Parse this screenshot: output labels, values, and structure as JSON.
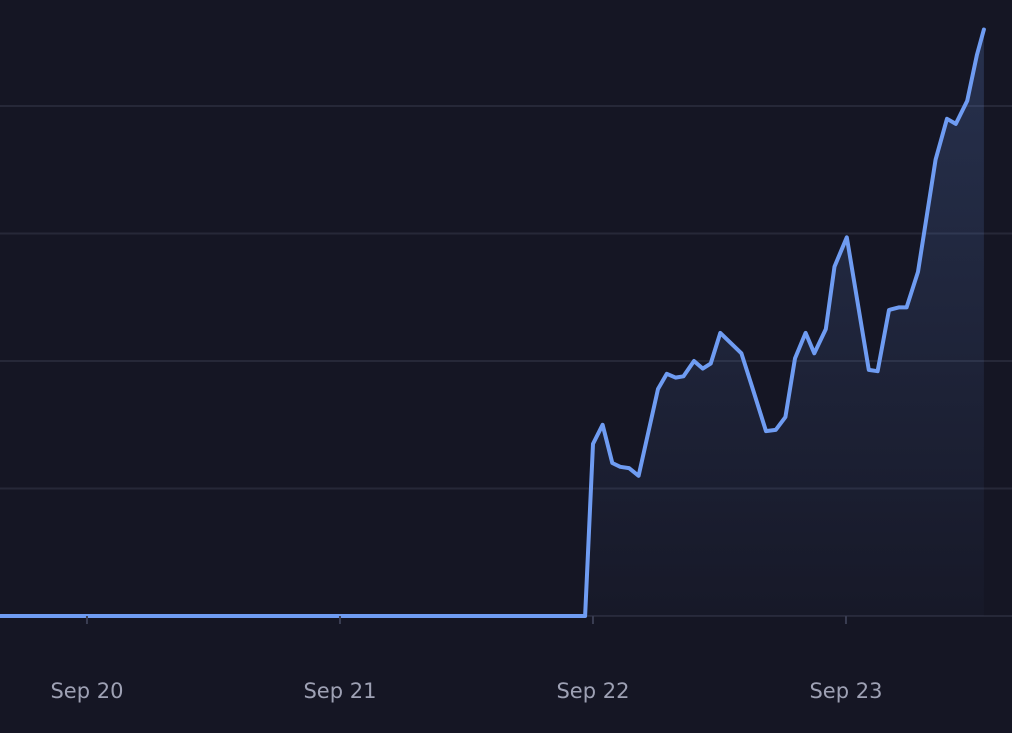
{
  "colors": {
    "background": "#151624",
    "line": "#6f9cf2",
    "grid": "#262838",
    "axis_tick": "#3a3d52",
    "tick_label": "#9ea1b4"
  },
  "chart_data": {
    "type": "area",
    "title": "",
    "xlabel": "",
    "ylabel": "",
    "grid": true,
    "legend": "none",
    "x_ticks": [
      "Sep 20",
      "Sep 21",
      "Sep 22",
      "Sep 23"
    ],
    "xlim": [
      "Sep 19 15:45",
      "Sep 23 15:45"
    ],
    "ylim": [
      0,
      4.5
    ],
    "y_gridlines": [
      0,
      1,
      2,
      3,
      4
    ],
    "series": [
      {
        "values": [
          {
            "x": "Sep 19 15:45",
            "y": 0
          },
          {
            "x": "Sep 21 23:15",
            "y": 0
          },
          {
            "x": "Sep 22 00:00",
            "y": 1.35
          },
          {
            "x": "Sep 22 00:55",
            "y": 1.5
          },
          {
            "x": "Sep 22 01:50",
            "y": 1.2
          },
          {
            "x": "Sep 22 02:35",
            "y": 1.17
          },
          {
            "x": "Sep 22 03:25",
            "y": 1.16
          },
          {
            "x": "Sep 22 04:20",
            "y": 1.1
          },
          {
            "x": "Sep 22 06:10",
            "y": 1.78
          },
          {
            "x": "Sep 22 07:00",
            "y": 1.9
          },
          {
            "x": "Sep 22 07:50",
            "y": 1.87
          },
          {
            "x": "Sep 22 08:35",
            "y": 1.88
          },
          {
            "x": "Sep 22 09:35",
            "y": 2.0
          },
          {
            "x": "Sep 22 10:25",
            "y": 1.94
          },
          {
            "x": "Sep 22 11:10",
            "y": 1.98
          },
          {
            "x": "Sep 22 12:05",
            "y": 2.22
          },
          {
            "x": "Sep 22 14:05",
            "y": 2.06
          },
          {
            "x": "Sep 22 15:05",
            "y": 1.8
          },
          {
            "x": "Sep 22 16:25",
            "y": 1.45
          },
          {
            "x": "Sep 22 17:20",
            "y": 1.46
          },
          {
            "x": "Sep 22 18:15",
            "y": 1.56
          },
          {
            "x": "Sep 22 19:10",
            "y": 2.02
          },
          {
            "x": "Sep 22 20:10",
            "y": 2.22
          },
          {
            "x": "Sep 22 21:00",
            "y": 2.06
          },
          {
            "x": "Sep 22 22:05",
            "y": 2.25
          },
          {
            "x": "Sep 22 22:55",
            "y": 2.74
          },
          {
            "x": "Sep 23 00:05",
            "y": 2.97
          },
          {
            "x": "Sep 23 02:10",
            "y": 1.93
          },
          {
            "x": "Sep 23 03:00",
            "y": 1.92
          },
          {
            "x": "Sep 23 04:05",
            "y": 2.4
          },
          {
            "x": "Sep 23 05:00",
            "y": 2.42
          },
          {
            "x": "Sep 23 05:45",
            "y": 2.42
          },
          {
            "x": "Sep 23 06:50",
            "y": 2.7
          },
          {
            "x": "Sep 23 08:30",
            "y": 3.58
          },
          {
            "x": "Sep 23 09:35",
            "y": 3.9
          },
          {
            "x": "Sep 23 10:25",
            "y": 3.86
          },
          {
            "x": "Sep 23 11:30",
            "y": 4.04
          },
          {
            "x": "Sep 23 12:25",
            "y": 4.4
          },
          {
            "x": "Sep 23 13:05",
            "y": 4.6
          }
        ]
      }
    ]
  }
}
